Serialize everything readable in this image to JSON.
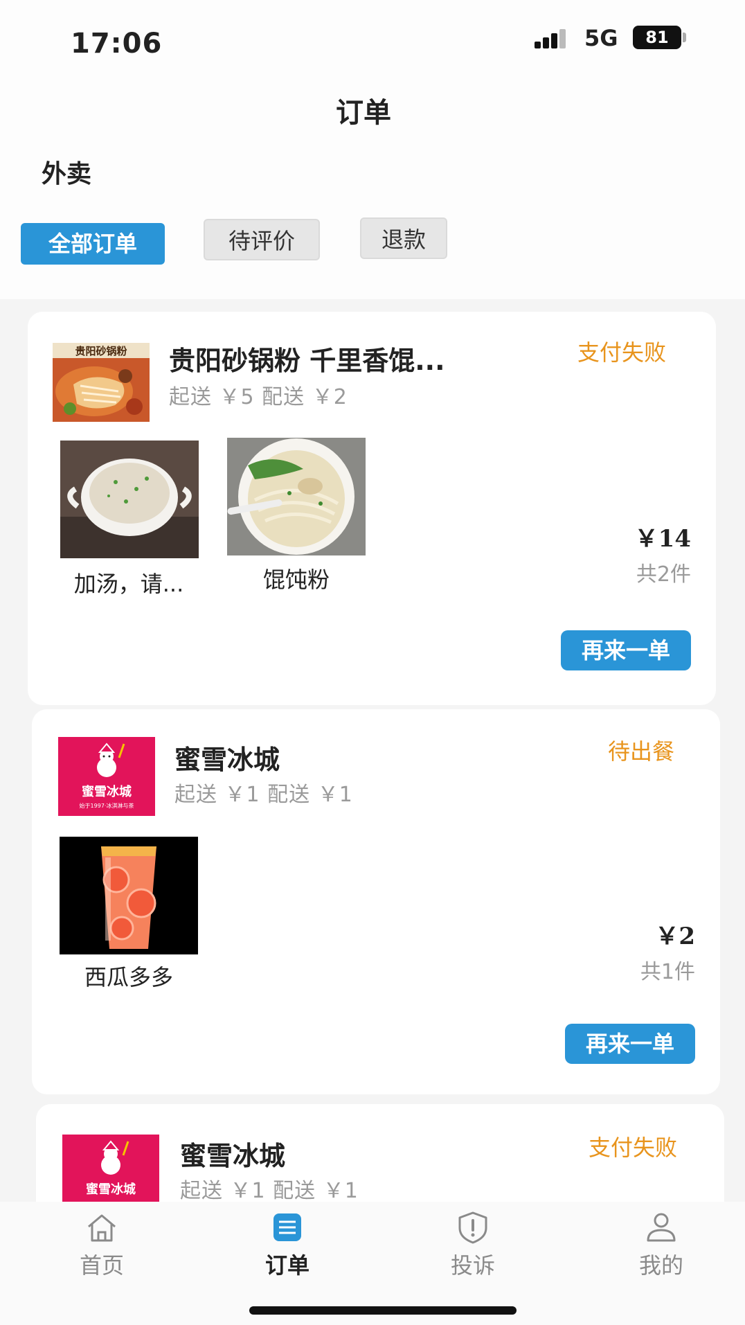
{
  "status_bar": {
    "time": "17:06",
    "network": "5G",
    "battery": "81"
  },
  "page_title": "订单",
  "section_label": "外卖",
  "filters": [
    {
      "label": "全部订单",
      "active": true
    },
    {
      "label": "待评价",
      "active": false
    },
    {
      "label": "退款",
      "active": false
    }
  ],
  "orders": [
    {
      "shop_name": "贵阳砂锅粉 千里香馄...",
      "logo_text": "贵阳砂锅粉",
      "fees": "起送 ￥5  配送 ￥2",
      "status": "支付失败",
      "items": [
        {
          "name": "加汤，请..."
        },
        {
          "name": "馄饨粉"
        }
      ],
      "price": "￥14",
      "count": "共2件",
      "reorder_label": "再来一单"
    },
    {
      "shop_name": "蜜雪冰城",
      "logo_text": "蜜雪冰城",
      "logo_subtext": "始于1997·冰淇淋与茶",
      "fees": "起送 ￥1  配送 ￥1",
      "status": "待出餐",
      "items": [
        {
          "name": "西瓜多多"
        }
      ],
      "price": "￥2",
      "count": "共1件",
      "reorder_label": "再来一单"
    },
    {
      "shop_name": "蜜雪冰城",
      "logo_text": "蜜雪冰城",
      "fees": "起送 ￥1  配送 ￥1",
      "status": "支付失败"
    }
  ],
  "tabbar": [
    {
      "label": "首页",
      "icon": "home-icon",
      "active": false
    },
    {
      "label": "订单",
      "icon": "order-list-icon",
      "active": true
    },
    {
      "label": "投诉",
      "icon": "complaint-shield-icon",
      "active": false
    },
    {
      "label": "我的",
      "icon": "user-profile-icon",
      "active": false
    }
  ],
  "colors": {
    "accent_blue": "#2a95d7",
    "status_orange": "#e8941d",
    "brand_red": "#e2145a"
  }
}
